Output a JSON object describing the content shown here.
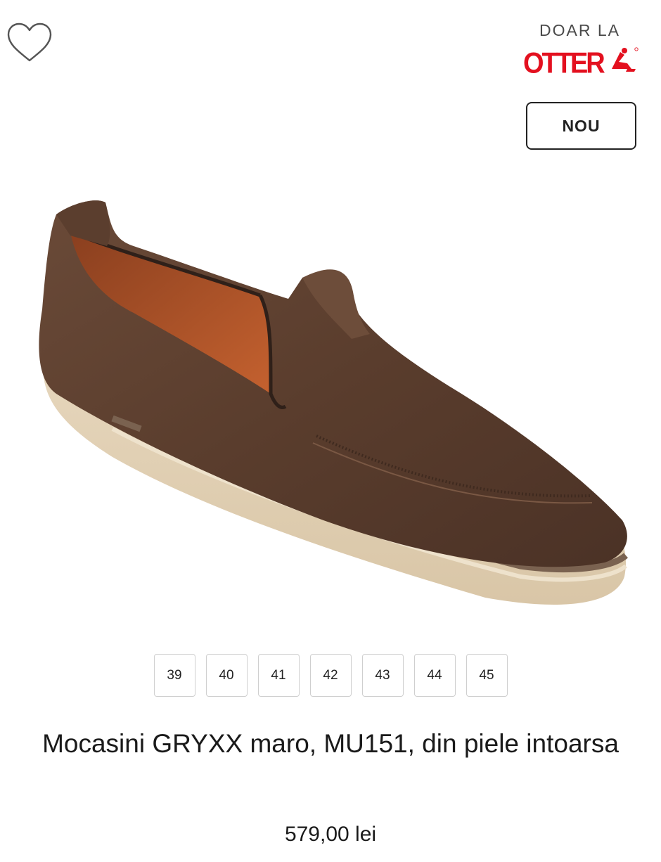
{
  "product_card": {
    "exclusive": {
      "label": "DOAR LA",
      "brand_logo_text": "OTTER",
      "brand_color": "#e3101f"
    },
    "badge": "NOU",
    "icons": {
      "wishlist": "heart-outline-icon"
    },
    "sizes": [
      {
        "label": "39"
      },
      {
        "label": "40"
      },
      {
        "label": "41"
      },
      {
        "label": "42"
      },
      {
        "label": "43"
      },
      {
        "label": "44"
      },
      {
        "label": "45"
      }
    ],
    "title": "Mocasini GRYXX maro, MU151, din piele intoarsa",
    "price": "579,00 lei"
  }
}
